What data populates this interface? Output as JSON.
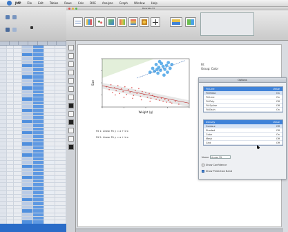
{
  "colors": {
    "accent": "#3f82d8",
    "group_blue": "#4aa3e6",
    "group_red": "#e05a5a",
    "group_green": "#8fbf6a",
    "left_status": "#2a6cc8"
  },
  "menubar": {
    "items": [
      "JMP",
      "File",
      "Edit",
      "Tables",
      "Rows",
      "Cols",
      "DOE",
      "Analyze",
      "Graph",
      "Window",
      "Help"
    ]
  },
  "window_title": "Bivariate Fit",
  "toolbar": {
    "buttons": [
      "table-icon",
      "chart-icon",
      "scatter-icon",
      "map-icon",
      "color-icon",
      "spectrum-icon",
      "paint-icon",
      "crosshair-icon",
      "zoom-icon"
    ]
  },
  "plot": {
    "xlabel": "Weight (g)",
    "ylabel": "Size",
    "eq1": "Fit 1: Linear Fit y = a + b·x",
    "eq2": "Fit 2: Linear Fit y = a + b·x"
  },
  "chart_data": {
    "type": "scatter",
    "title": "",
    "xlabel": "Weight (g)",
    "ylabel": "Size",
    "xlim": [
      0,
      100
    ],
    "ylim": [
      0,
      100
    ],
    "grid": false,
    "series": [
      {
        "color": "#4aa3e6",
        "points": [
          [
            55,
            72
          ],
          [
            58,
            80
          ],
          [
            60,
            74
          ],
          [
            62,
            88
          ],
          [
            64,
            70
          ],
          [
            65,
            82
          ],
          [
            67,
            76
          ],
          [
            68,
            90
          ],
          [
            70,
            84
          ],
          [
            72,
            78
          ],
          [
            74,
            86
          ],
          [
            75,
            72
          ],
          [
            76,
            92
          ],
          [
            78,
            80
          ],
          [
            80,
            88
          ],
          [
            66,
            94
          ],
          [
            71,
            66
          ],
          [
            63,
            78
          ]
        ]
      },
      {
        "color": "#e05a5a",
        "points": [
          [
            5,
            42
          ],
          [
            8,
            36
          ],
          [
            10,
            46
          ],
          [
            12,
            30
          ],
          [
            14,
            40
          ],
          [
            16,
            34
          ],
          [
            18,
            44
          ],
          [
            20,
            28
          ],
          [
            22,
            38
          ],
          [
            24,
            32
          ],
          [
            26,
            42
          ],
          [
            28,
            26
          ],
          [
            30,
            36
          ],
          [
            32,
            30
          ],
          [
            34,
            40
          ],
          [
            36,
            24
          ],
          [
            38,
            34
          ],
          [
            40,
            28
          ],
          [
            42,
            38
          ],
          [
            44,
            22
          ],
          [
            46,
            32
          ],
          [
            48,
            26
          ],
          [
            50,
            30
          ],
          [
            52,
            20
          ],
          [
            54,
            28
          ],
          [
            56,
            18
          ],
          [
            58,
            24
          ],
          [
            60,
            22
          ],
          [
            62,
            16
          ],
          [
            64,
            20
          ],
          [
            66,
            14
          ],
          [
            68,
            18
          ],
          [
            70,
            12
          ],
          [
            72,
            16
          ],
          [
            74,
            10
          ],
          [
            76,
            14
          ],
          [
            78,
            10
          ],
          [
            80,
            8
          ],
          [
            84,
            12
          ],
          [
            88,
            6
          ],
          [
            15,
            25
          ],
          [
            25,
            20
          ],
          [
            35,
            18
          ],
          [
            45,
            15
          ],
          [
            55,
            12
          ]
        ]
      }
    ],
    "fit_lines": [
      {
        "from": [
          0,
          44
        ],
        "to": [
          100,
          8
        ]
      },
      {
        "from": [
          40,
          60
        ],
        "to": [
          95,
          96
        ]
      }
    ]
  },
  "panel": {
    "header": "Fit",
    "subheader": "Group: Color",
    "title": "Options",
    "section1": {
      "title": "Fit Line",
      "col": "Value",
      "rows": [
        {
          "label": "Fit Mean",
          "value": "On"
        },
        {
          "label": "Fit Line",
          "value": "On"
        },
        {
          "label": "Fit Poly",
          "value": "Off"
        },
        {
          "label": "Fit Spline",
          "value": "Off"
        },
        {
          "label": "Fit Each",
          "value": "On"
        }
      ]
    },
    "section2": {
      "title": "Density",
      "col": "Value",
      "rows": [
        {
          "label": "Contour",
          "value": "Off"
        },
        {
          "label": "Shaded",
          "value": "Off"
        },
        {
          "label": "Color",
          "value": "On"
        },
        {
          "label": "Mesh",
          "value": "Off"
        },
        {
          "label": "Grid",
          "value": "Off"
        }
      ]
    },
    "field_label": "Name",
    "field_value": "Linear Fit",
    "check1": "Show Confidence",
    "check2": "Show Prediction Band"
  }
}
